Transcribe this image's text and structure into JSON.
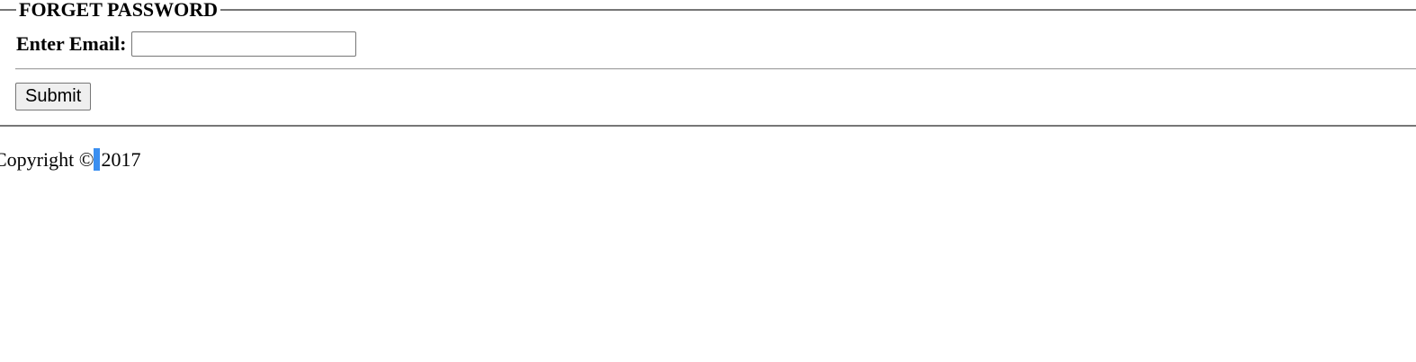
{
  "form": {
    "legend": "FORGET PASSWORD",
    "email_label": "Enter Email:",
    "email_value": "",
    "email_placeholder": "",
    "submit_label": "Submit"
  },
  "footer": {
    "copyright_prefix": "Copyright ©",
    "year": "2017",
    "selection_color": "#3b8ff0"
  }
}
